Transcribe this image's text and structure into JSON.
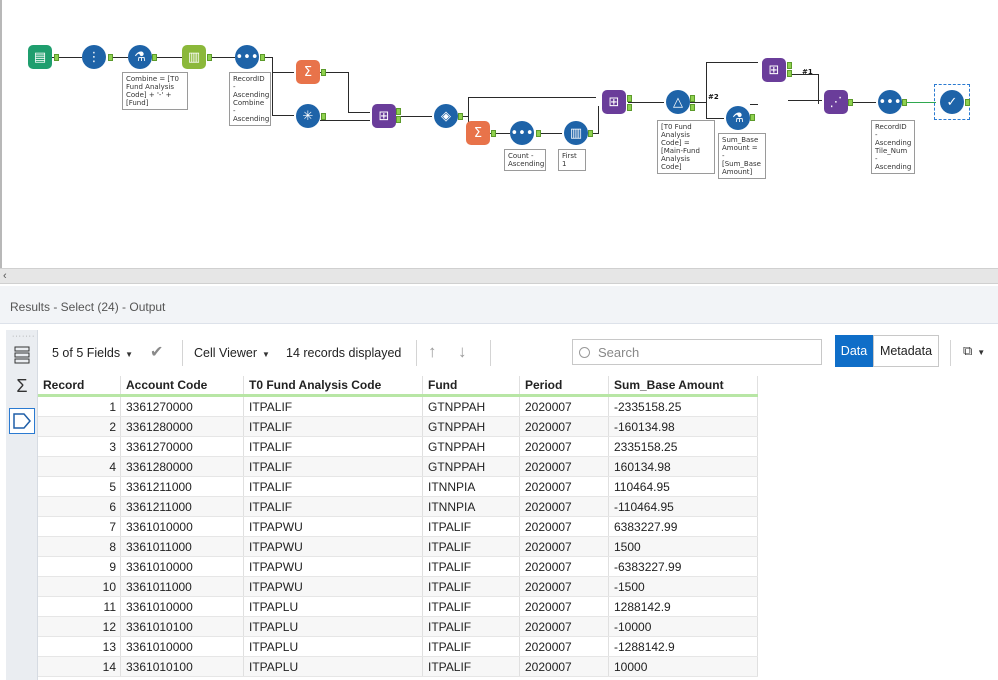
{
  "workflow": {
    "annotations": {
      "formula1": "Combine = [T0 Fund Analysis Code] + '-' + [Fund]",
      "sort1": "RecordID - Ascending Combine - Ascending",
      "sort2": "Count - Ascending",
      "sample": "First 1",
      "filter": "[T0 Fund Analysis Code] = [Main-Fund Analysis Code]",
      "formula2": "Sum_Base Amount = -[Sum_Base Amount]",
      "sort3": "RecordID - Ascending Tile_Num - Ascending"
    },
    "tags": {
      "t2": "#2",
      "t1": "#1"
    }
  },
  "results": {
    "title": "Results - Select (24) - Output"
  },
  "toolbar": {
    "fields_label": "5 of 5 Fields",
    "viewer_label": "Cell Viewer",
    "records_label": "14 records displayed",
    "search_placeholder": "Search",
    "data_label": "Data",
    "metadata_label": "Metadata"
  },
  "table": {
    "headers": [
      "Record",
      "Account Code",
      "T0  Fund Analysis Code",
      "Fund",
      "Period",
      "Sum_Base Amount"
    ],
    "rows": [
      [
        "1",
        "3361270000",
        "ITPALIF",
        "GTNPPAH",
        "2020007",
        "-2335158.25"
      ],
      [
        "2",
        "3361280000",
        "ITPALIF",
        "GTNPPAH",
        "2020007",
        "-160134.98"
      ],
      [
        "3",
        "3361270000",
        "ITPALIF",
        "GTNPPAH",
        "2020007",
        "2335158.25"
      ],
      [
        "4",
        "3361280000",
        "ITPALIF",
        "GTNPPAH",
        "2020007",
        "160134.98"
      ],
      [
        "5",
        "3361211000",
        "ITPALIF",
        "ITNNPIA",
        "2020007",
        "110464.95"
      ],
      [
        "6",
        "3361211000",
        "ITPALIF",
        "ITNNPIA",
        "2020007",
        "-110464.95"
      ],
      [
        "7",
        "3361010000",
        "ITPAPWU",
        "ITPALIF",
        "2020007",
        "6383227.99"
      ],
      [
        "8",
        "3361011000",
        "ITPAPWU",
        "ITPALIF",
        "2020007",
        "1500"
      ],
      [
        "9",
        "3361010000",
        "ITPAPWU",
        "ITPALIF",
        "2020007",
        "-6383227.99"
      ],
      [
        "10",
        "3361011000",
        "ITPAPWU",
        "ITPALIF",
        "2020007",
        "-1500"
      ],
      [
        "11",
        "3361010000",
        "ITPAPLU",
        "ITPALIF",
        "2020007",
        "1288142.9"
      ],
      [
        "12",
        "3361010100",
        "ITPAPLU",
        "ITPALIF",
        "2020007",
        "-10000"
      ],
      [
        "13",
        "3361010000",
        "ITPAPLU",
        "ITPALIF",
        "2020007",
        "-1288142.9"
      ],
      [
        "14",
        "3361010100",
        "ITPAPLU",
        "ITPALIF",
        "2020007",
        "10000"
      ]
    ]
  },
  "colors": {
    "accent": "#0f6ec8",
    "input_tool": "#1f9e6e",
    "prep_tool": "#1e63a8",
    "summarize_tool": "#e8734a",
    "join_tool": "#6a3d9a",
    "anchor": "#8fd14f"
  }
}
